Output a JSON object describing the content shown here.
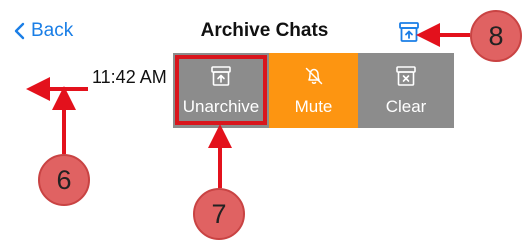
{
  "header": {
    "back_label": "Back",
    "title": "Archive Chats",
    "archive_icon": "archive-upload-icon"
  },
  "chat": {
    "time": "11:42 AM"
  },
  "actions": [
    {
      "label": "Unarchive",
      "icon": "archive-upload-icon",
      "color": "#8c8c8c"
    },
    {
      "label": "Mute",
      "icon": "bell-slash-icon",
      "color": "#fd9511"
    },
    {
      "label": "Clear",
      "icon": "clear-box-icon",
      "color": "#8c8c8c"
    }
  ],
  "annotations": {
    "marker_6": "6",
    "marker_7": "7",
    "marker_8": "8",
    "color": "#e06262",
    "arrow_color": "#e3111c"
  }
}
